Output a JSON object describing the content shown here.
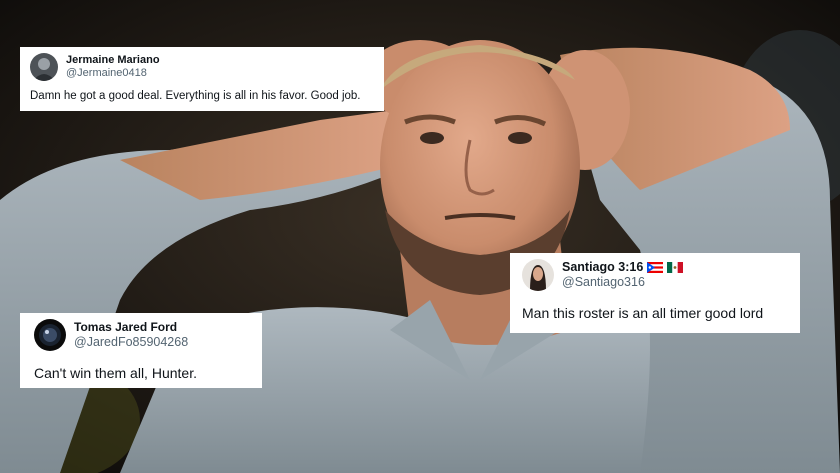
{
  "tweets": [
    {
      "name": "Jermaine Mariano",
      "handle": "@Jermaine0418",
      "text": "Damn he got a good deal. Everything is all in his favor. Good job."
    },
    {
      "name": "Santiago 3:16",
      "handle": "@Santiago316",
      "text": "Man this roster is an all timer good lord",
      "flags": [
        "puerto-rico-flag",
        "mexico-flag"
      ]
    },
    {
      "name": "Tomas Jared Ford",
      "handle": "@JaredFo85904268",
      "text": "Can't win them all, Hunter."
    }
  ]
}
